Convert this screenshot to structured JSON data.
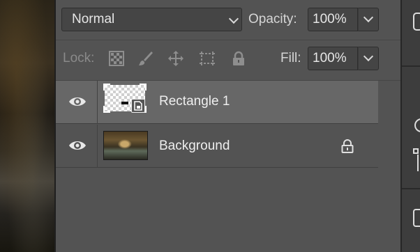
{
  "layers_panel": {
    "blend_mode": "Normal",
    "opacity_label": "Opacity:",
    "opacity_value": "100%",
    "lock_label": "Lock:",
    "fill_label": "Fill:",
    "fill_value": "100%",
    "lock_icons": [
      "transparency-lock-icon",
      "brush-lock-icon",
      "move-lock-icon",
      "artboard-lock-icon",
      "padlock-icon"
    ],
    "layers": [
      {
        "name": "Rectangle 1",
        "visible": true,
        "selected": true,
        "type": "smart-object"
      },
      {
        "name": "Background",
        "visible": true,
        "selected": false,
        "locked": true
      }
    ]
  },
  "colors": {
    "panel_bg": "#535353",
    "selected_row": "#676767",
    "field_bg": "#454545"
  }
}
